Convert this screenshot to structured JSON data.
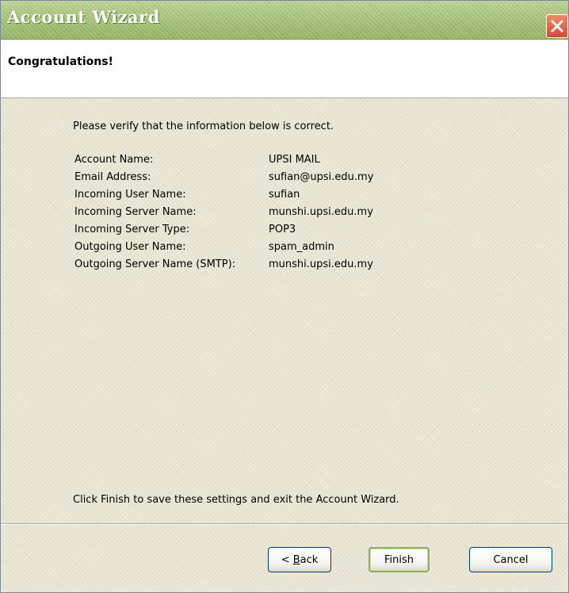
{
  "window": {
    "title": "Account Wizard",
    "close_icon": "close-icon"
  },
  "header": {
    "title": "Congratulations!"
  },
  "main": {
    "intro": "Please verify that the information below is correct.",
    "fields": [
      {
        "label": "Account Name:",
        "value": "UPSI MAIL"
      },
      {
        "label": "Email Address:",
        "value": "sufian@upsi.edu.my"
      },
      {
        "label": "Incoming User Name:",
        "value": "sufian"
      },
      {
        "label": "Incoming Server Name:",
        "value": "munshi.upsi.edu.my"
      },
      {
        "label": "Incoming Server Type:",
        "value": "POP3"
      },
      {
        "label": "Outgoing User Name:",
        "value": "spam_admin"
      },
      {
        "label": "Outgoing Server Name (SMTP):",
        "value": "munshi.upsi.edu.my"
      }
    ],
    "finish_note": "Click Finish to save these settings and exit the Account Wizard."
  },
  "buttons": {
    "back_prefix": "< ",
    "back_accel": "B",
    "back_rest": "ack",
    "finish": "Finish",
    "cancel": "Cancel"
  },
  "colors": {
    "titlebar": "#a7c279",
    "close": "#d9472a",
    "dialog_bg": "#ece9d8"
  }
}
